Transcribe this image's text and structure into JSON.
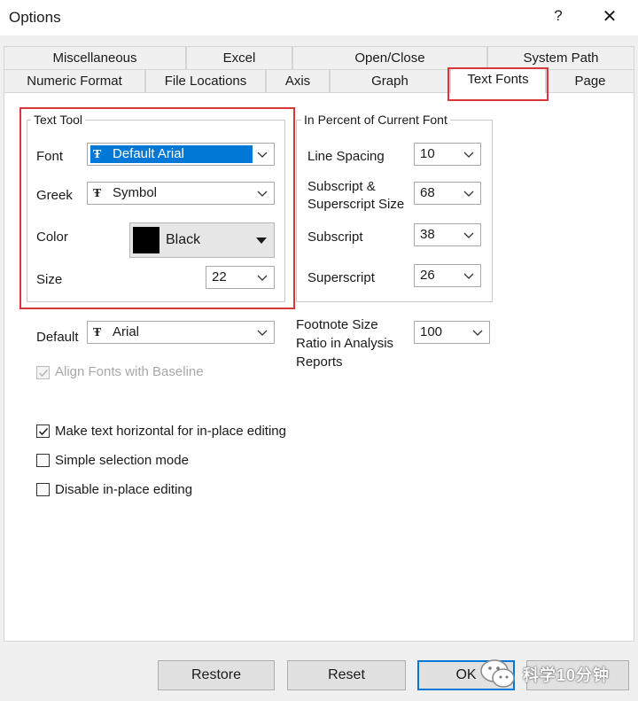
{
  "window": {
    "title": "Options",
    "help": "?",
    "close": "✕"
  },
  "tabs": {
    "row1": [
      "Miscellaneous",
      "Excel",
      "Open/Close",
      "System Path"
    ],
    "row2": [
      "Numeric Format",
      "File Locations",
      "Axis",
      "Graph",
      "Text Fonts",
      "Page"
    ],
    "active": "Text Fonts"
  },
  "text_tool": {
    "title": "Text Tool",
    "font_label": "Font",
    "font_value": "Default Arial",
    "greek_label": "Greek",
    "greek_value": "Symbol",
    "color_label": "Color",
    "color_value": "Black",
    "color_swatch": "#000000",
    "size_label": "Size",
    "size_value": "22"
  },
  "percent": {
    "title": "In Percent of Current Font",
    "line_spacing_label": "Line Spacing",
    "line_spacing_value": "10",
    "subsup_label_1": "Subscript &",
    "subsup_label_2": "Superscript Size",
    "subsup_value": "68",
    "subscript_label": "Subscript",
    "subscript_value": "38",
    "superscript_label": "Superscript",
    "superscript_value": "26"
  },
  "default_font": {
    "label": "Default",
    "value": "Arial"
  },
  "footnote": {
    "label_1": "Footnote Size",
    "label_2": "Ratio in Analysis",
    "label_3": "Reports",
    "value": "100"
  },
  "options": {
    "align": {
      "label": "Align Fonts with Baseline",
      "checked": true,
      "disabled": true
    },
    "horizontal": {
      "label": "Make text horizontal for in-place editing",
      "checked": true
    },
    "simple": {
      "label": "Simple selection mode",
      "checked": false
    },
    "disable": {
      "label": "Disable in-place editing",
      "checked": false
    }
  },
  "buttons": {
    "restore": "Restore",
    "reset": "Reset",
    "ok": "OK"
  },
  "watermark": {
    "text": "科学10分钟"
  },
  "colors": {
    "accent": "#0078d7",
    "highlight_box": "#d93838"
  }
}
